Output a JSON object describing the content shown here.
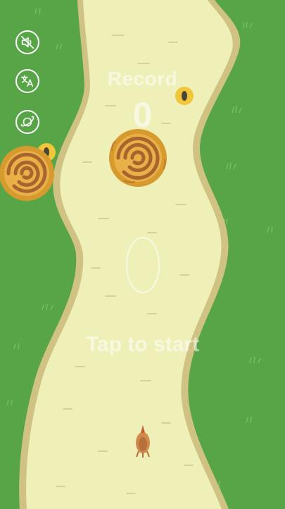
{
  "controls": {
    "sound": {
      "icon": "speaker-muted-icon"
    },
    "language": {
      "icon": "translate-icon"
    },
    "theme": {
      "icon": "planet-icon"
    }
  },
  "hud": {
    "record_label": "Record",
    "record_value": "0",
    "start_prompt": "Tap to start"
  },
  "colors": {
    "grass": "#58a548",
    "path": "#eef0b8",
    "path_edge": "#cfc283",
    "hay_outer": "#d79a2e",
    "hay_inner": "#a9642e",
    "seed_ring": "#f0c63b"
  },
  "sprites": {
    "player": "chicken",
    "obstacle": "hay-bale",
    "pickup": "seed"
  }
}
